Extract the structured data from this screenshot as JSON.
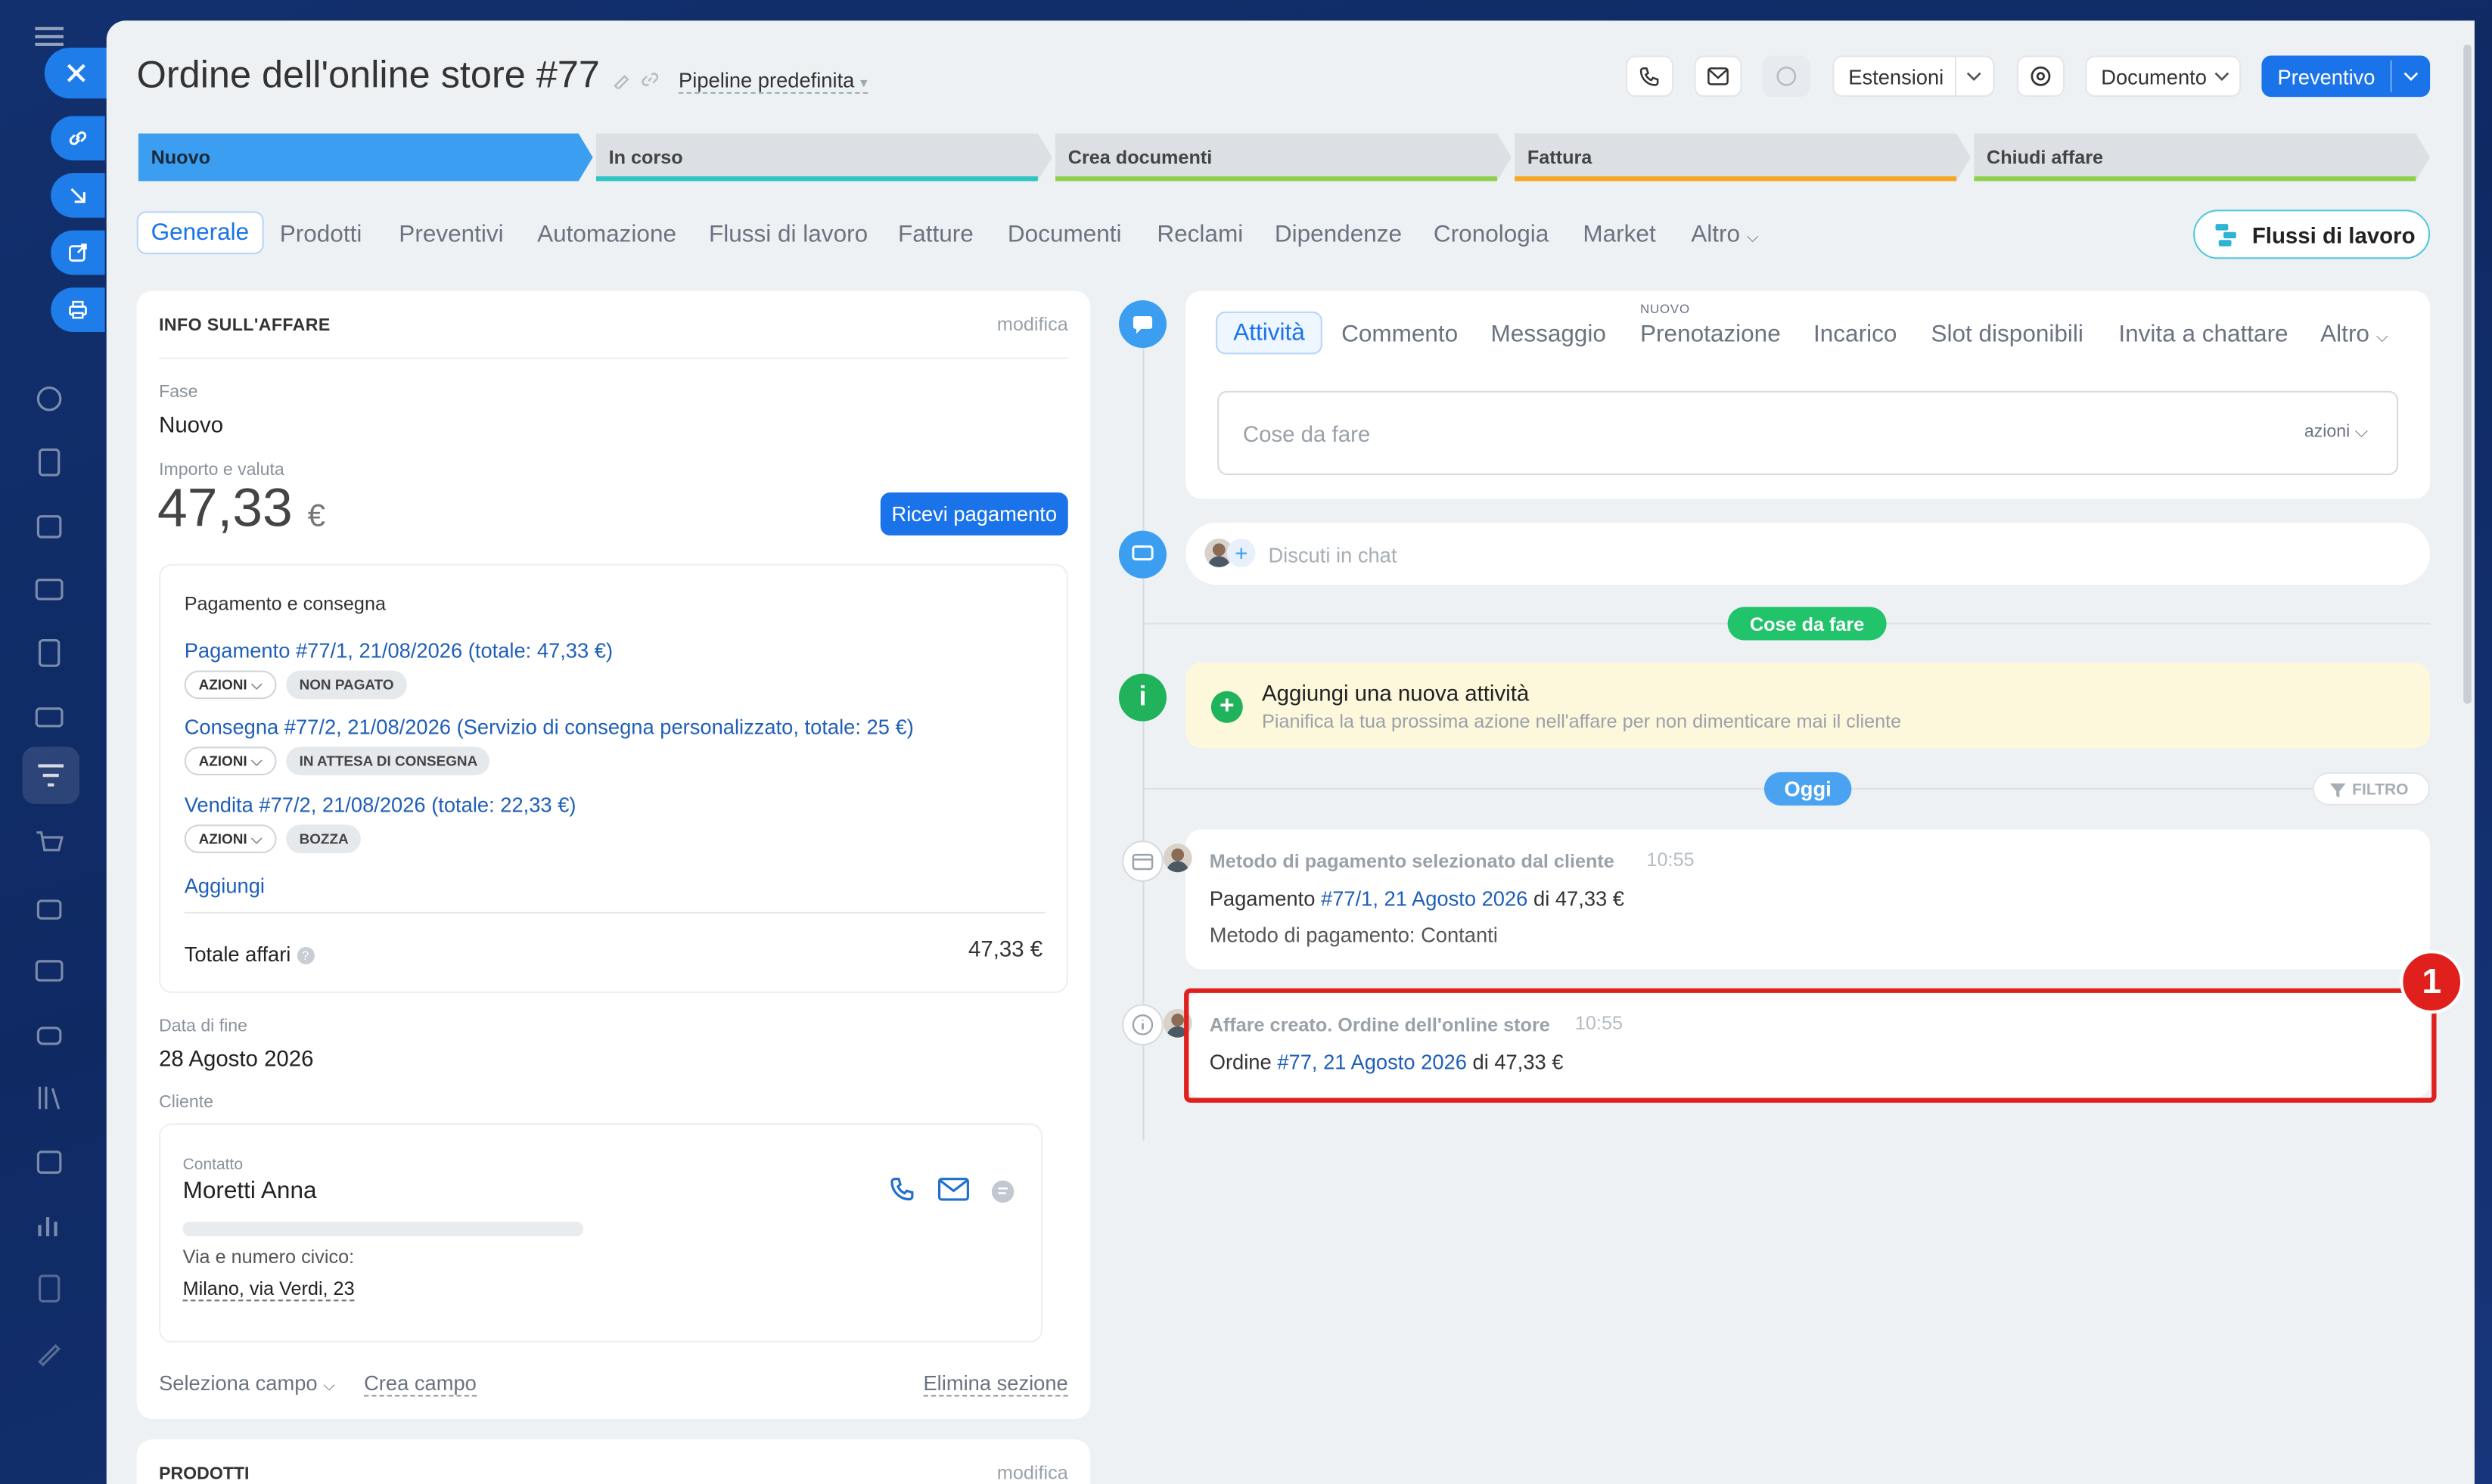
{
  "header": {
    "title": "Ordine dell'online store #77",
    "pipeline": "Pipeline predefinita",
    "extensions_label": "Estensioni",
    "document_label": "Documento",
    "quote_label": "Preventivo"
  },
  "stages": [
    {
      "label": "Nuovo",
      "color": "#3b9ef0"
    },
    {
      "label": "In corso",
      "color": "#2ec4c0"
    },
    {
      "label": "Crea documenti",
      "color": "#8fd14f"
    },
    {
      "label": "Fattura",
      "color": "#f5a623"
    },
    {
      "label": "Chiudi affare",
      "color": "#8fd14f"
    }
  ],
  "tabs": [
    "Generale",
    "Prodotti",
    "Preventivi",
    "Automazione",
    "Flussi di lavoro",
    "Fatture",
    "Documenti",
    "Reclami",
    "Dipendenze",
    "Cronologia",
    "Market",
    "Altro"
  ],
  "workflows_button": "Flussi di lavoro",
  "deal_info": {
    "heading": "INFO SULL'AFFARE",
    "edit": "modifica",
    "stage_label": "Fase",
    "stage_value": "Nuovo",
    "amount_label": "Importo e valuta",
    "amount": "47,33",
    "currency": "€",
    "receive_payment": "Ricevi pagamento",
    "payment_box": {
      "title": "Pagamento e consegna",
      "items": [
        {
          "link": "Pagamento #77/1, 21/08/2026 (totale: 47,33 €)",
          "action": "AZIONI",
          "status": "NON PAGATO"
        },
        {
          "link": "Consegna #77/2, 21/08/2026 (Servizio di consegna personalizzato, totale: 25 €)",
          "action": "AZIONI",
          "status": "IN ATTESA DI CONSEGNA"
        },
        {
          "link": "Vendita #77/2, 21/08/2026 (totale: 22,33 €)",
          "action": "AZIONI",
          "status": "BOZZA"
        }
      ],
      "add": "Aggiungi",
      "total_label": "Totale affari",
      "total_value": "47,33 €"
    },
    "end_date_label": "Data di fine",
    "end_date": "28 Agosto 2026",
    "client_label": "Cliente",
    "contact": {
      "type": "Contatto",
      "name": "Moretti Anna",
      "address_label": "Via e numero civico:",
      "address": "Milano, via Verdi, 23"
    },
    "select_field": "Seleziona campo",
    "create_field": "Crea campo",
    "delete_section": "Elimina sezione"
  },
  "products": {
    "heading": "PRODOTTI",
    "edit": "modifica"
  },
  "activity": {
    "tabs": [
      "Attività",
      "Commento",
      "Messaggio",
      "Prenotazione",
      "Incarico",
      "Slot disponibili",
      "Invita a chattare",
      "Altro"
    ],
    "new_badge": "NUOVO",
    "todo_placeholder": "Cose da fare",
    "actions": "azioni",
    "chat_placeholder": "Discuti in chat"
  },
  "timeline": {
    "todo_badge": "Cose da fare",
    "add_activity_title": "Aggiungi una nuova attività",
    "add_activity_sub": "Pianifica la tua prossima azione nell'affare per non dimenticare mai il cliente",
    "today_badge": "Oggi",
    "filter": "FILTRO",
    "events": [
      {
        "title": "Metodo di pagamento selezionato dal cliente",
        "time": "10:55",
        "line1_prefix": "Pagamento",
        "line1_link": "#77/1, 21 Agosto 2026",
        "line1_suffix": "di 47,33 €",
        "line2": "Metodo di pagamento: Contanti"
      },
      {
        "title": "Affare creato. Ordine dell'online store",
        "time": "10:55",
        "line1_prefix": "Ordine",
        "line1_link": "#77, 21 Agosto 2026",
        "line1_suffix": "di 47,33 €"
      }
    ],
    "marker": "1"
  },
  "colors": {
    "accent": "#1a73e8",
    "highlight": "#e0201c",
    "success": "#21b35b"
  }
}
